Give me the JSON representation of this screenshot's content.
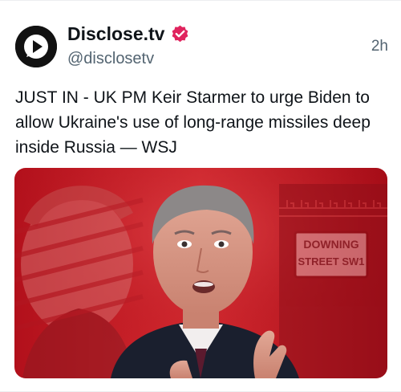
{
  "post": {
    "author_name": "Disclose.tv",
    "handle": "@disclosetv",
    "timestamp": "2h",
    "text": "JUST IN - UK PM Keir Starmer to urge Biden to allow Ukraine's use of long-range missiles deep inside Russia — WSJ",
    "verified": true,
    "avatar_icon": "disclose-play-logo",
    "verified_icon": "verified-badge-icon",
    "badge_color": "#e0245e",
    "media": {
      "description_icon": "news-photo",
      "sign_line1": "DOWNING",
      "sign_line2": "STREET SW1",
      "tint_color": "#c8202a"
    }
  }
}
